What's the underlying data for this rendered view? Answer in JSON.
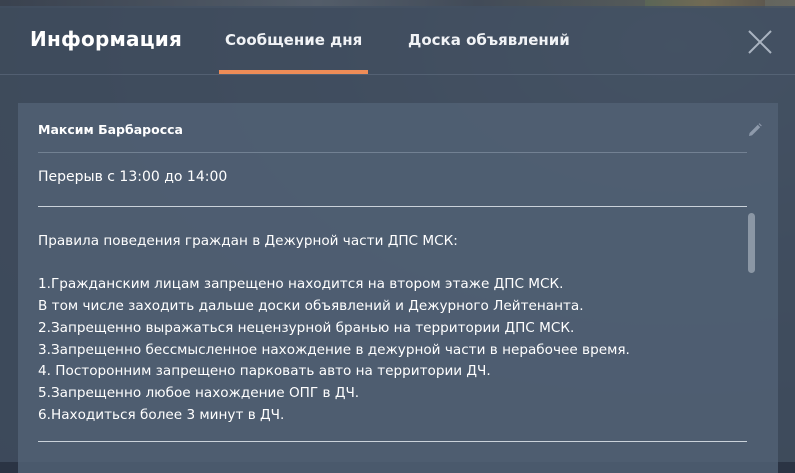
{
  "window": {
    "title": "Информация"
  },
  "tabs": [
    {
      "label": "Сообщение дня",
      "active": true
    },
    {
      "label": "Доска объявлений",
      "active": false
    }
  ],
  "icons": {
    "close": "close-icon",
    "edit": "pencil-icon"
  },
  "colors": {
    "accent": "#ee8c57",
    "text": "#ffffff"
  },
  "post": {
    "author": "Максим Барбаросса",
    "message": "Перерыв с 13:00 до 14:00",
    "rules": {
      "heading": "Правила поведения граждан в Дежурной части ДПС МСК:",
      "items": [
        "1.Гражданским лицам запрещено находится на втором этаже ДПС МСК.",
        "В том числе заходить дальше доски объявлений и Дежурного Лейтенанта.",
        "2.Запрещенно выражаться нецензурной бранью на территории ДПС МСК.",
        "3.Запрещенно бессмысленное нахождение в дежурной части в нерабочее время.",
        "4. Посторонним запрещено парковать авто на территории ДЧ.",
        "5.Запрещенно любое нахождение ОПГ в ДЧ.",
        "6.Находиться более 3 минут в ДЧ."
      ]
    }
  }
}
